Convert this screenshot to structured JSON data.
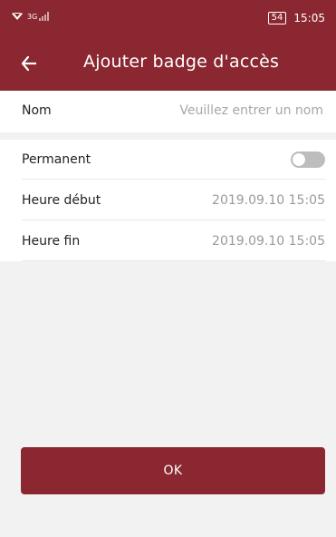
{
  "status_bar": {
    "network_label": "3G",
    "battery_label": "54",
    "time": "15:05"
  },
  "header": {
    "title": "Ajouter badge d'accès",
    "back_icon": "arrow-left-icon"
  },
  "form": {
    "name": {
      "label": "Nom",
      "placeholder": "Veuillez entrer un nom",
      "value": ""
    },
    "permanent": {
      "label": "Permanent",
      "enabled": false
    },
    "start_time": {
      "label": "Heure début",
      "value": "2019.09.10 15:05"
    },
    "end_time": {
      "label": "Heure fin",
      "value": "2019.09.10 15:05"
    }
  },
  "actions": {
    "ok_label": "OK"
  },
  "colors": {
    "brand": "#8a2731",
    "toggle_off": "#bdbdbd",
    "muted_text": "#9a9a9a"
  }
}
